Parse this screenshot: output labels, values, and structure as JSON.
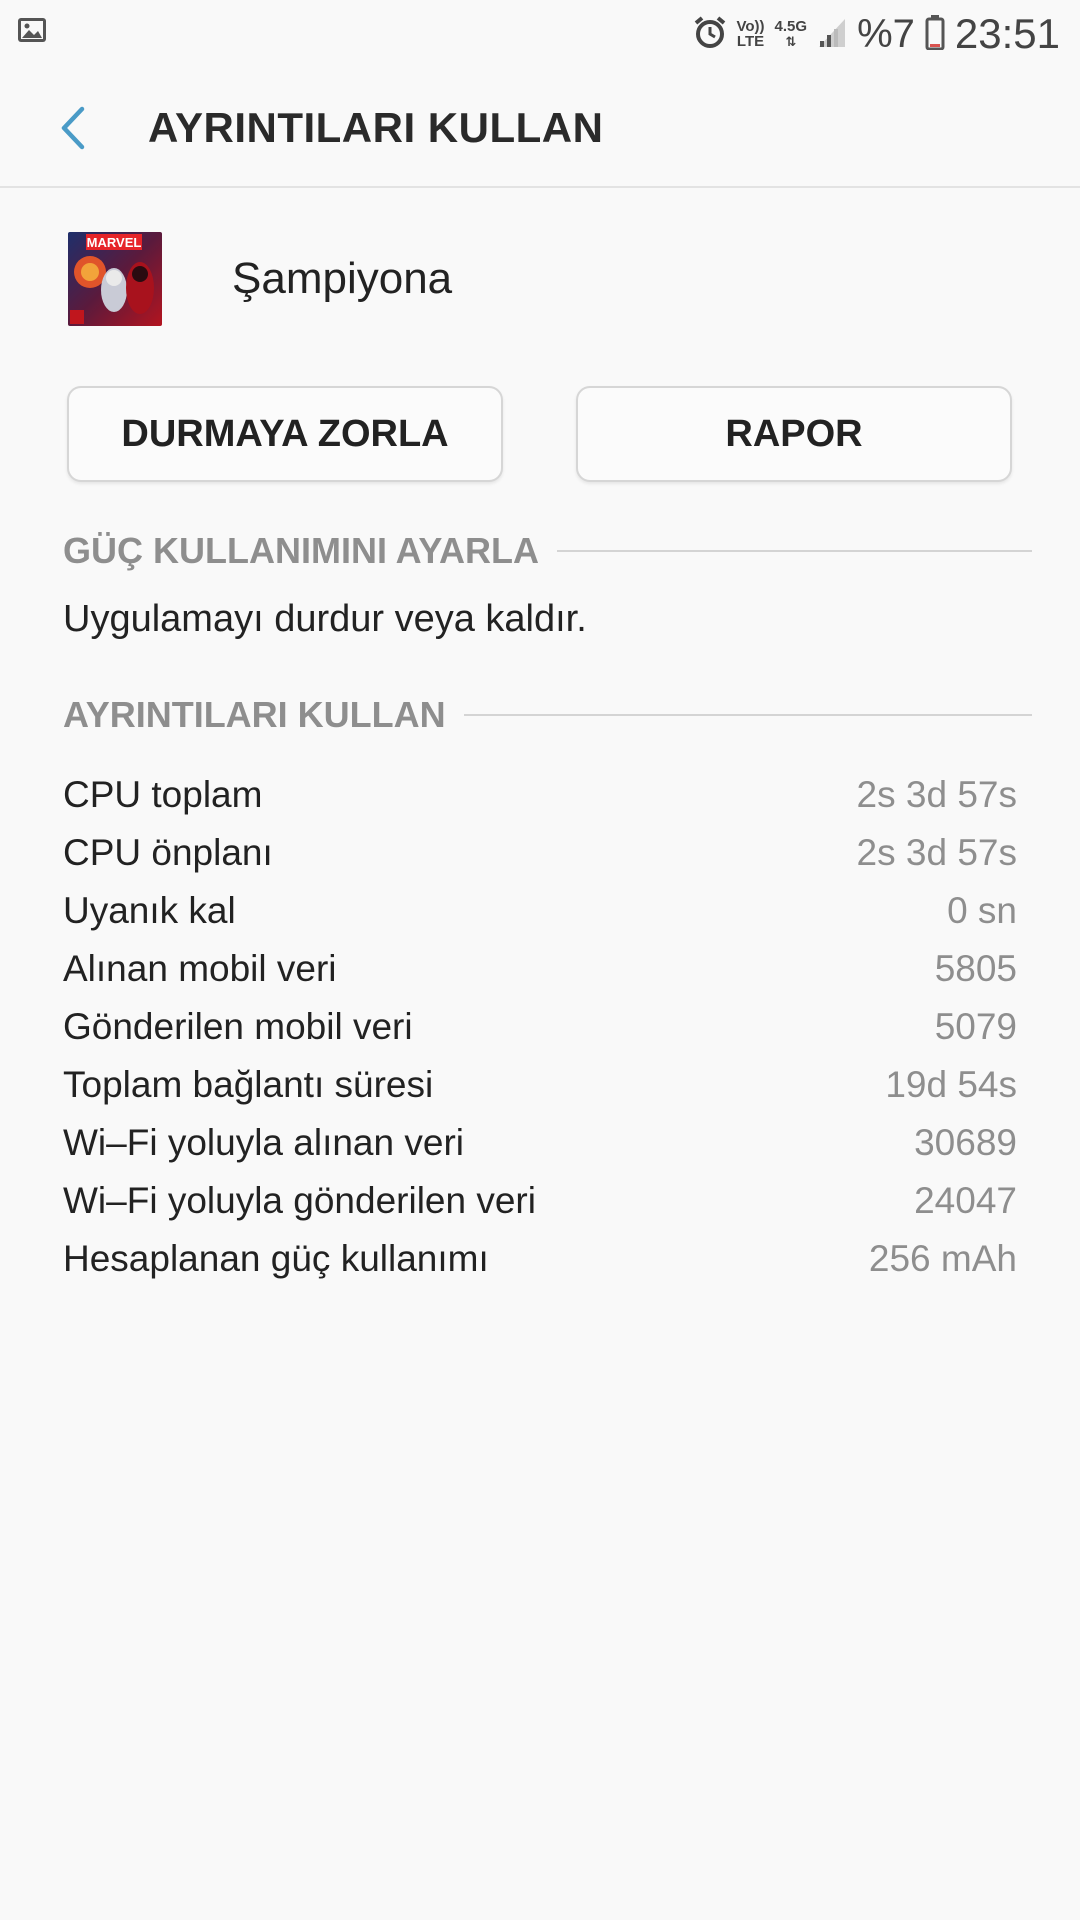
{
  "status_bar": {
    "left_icon": "gallery-icon",
    "alarm_icon": "alarm-icon",
    "volte_top": "Vo))",
    "volte_bottom": "LTE",
    "network_type": "4.5G",
    "signal_icon": "signal-icon",
    "battery": "%7",
    "battery_icon": "battery-icon",
    "time": "23:51"
  },
  "app_bar": {
    "back_icon": "back-arrow-icon",
    "title": "AYRINTILARI KULLAN",
    "accent_color": "#4a9bc7"
  },
  "app": {
    "icon_label": "MARVEL",
    "name": "Şampiyona"
  },
  "buttons": {
    "force_stop": "DURMAYA ZORLA",
    "report": "RAPOR"
  },
  "power_section": {
    "title": "GÜÇ KULLANIMINI AYARLA",
    "description": "Uygulamayı durdur veya kaldır."
  },
  "details_section": {
    "title": "AYRINTILARI KULLAN",
    "rows": [
      {
        "label": "CPU toplam",
        "value": "2s 3d 57s"
      },
      {
        "label": "CPU önplanı",
        "value": "2s 3d 57s"
      },
      {
        "label": "Uyanık kal",
        "value": "0 sn"
      },
      {
        "label": "Alınan mobil veri",
        "value": "5805"
      },
      {
        "label": "Gönderilen mobil veri",
        "value": "5079"
      },
      {
        "label": "Toplam bağlantı süresi",
        "value": "19d 54s"
      },
      {
        "label": "Wi–Fi yoluyla alınan veri",
        "value": "30689"
      },
      {
        "label": "Wi–Fi yoluyla gönderilen veri",
        "value": "24047"
      },
      {
        "label": "Hesaplanan güç kullanımı",
        "value": "256 mAh"
      }
    ]
  }
}
